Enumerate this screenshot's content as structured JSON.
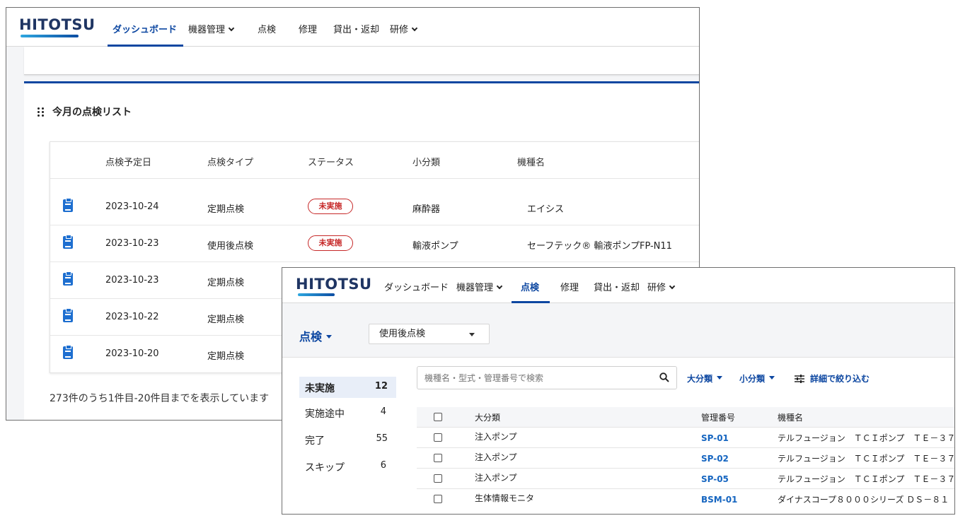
{
  "brand": {
    "logo": "HITOTSU",
    "colors": {
      "primary": "#0d47a1",
      "danger": "#c62828",
      "link": "#1565c0"
    }
  },
  "screen1": {
    "nav": {
      "items": [
        "ダッシュボード",
        "機器管理",
        "点検",
        "修理",
        "貸出・返却",
        "研修"
      ],
      "active": "ダッシュボード"
    },
    "card_title": "今月の点検リスト",
    "columns": [
      "点検予定日",
      "点検タイプ",
      "ステータス",
      "小分類",
      "機種名"
    ],
    "rows": [
      {
        "date": "2023-10-24",
        "type": "定期点検",
        "status": "未実施",
        "category": "麻酔器",
        "model": "エイシス"
      },
      {
        "date": "2023-10-23",
        "type": "使用後点検",
        "status": "未実施",
        "category": "輸液ポンプ",
        "model": "セーフテック® 輸液ポンプFP-N11"
      },
      {
        "date": "2023-10-23",
        "type": "定期点検",
        "status": "",
        "category": "",
        "model": ""
      },
      {
        "date": "2023-10-22",
        "type": "定期点検",
        "status": "",
        "category": "",
        "model": ""
      },
      {
        "date": "2023-10-20",
        "type": "定期点検",
        "status": "",
        "category": "",
        "model": ""
      }
    ],
    "footer": "273件のうち1件目-20件目までを表示しています",
    "icons": {
      "drag": "drag-handle-icon",
      "row": "clipboard-icon"
    }
  },
  "screen2": {
    "nav": {
      "items": [
        "ダッシュボード",
        "機器管理",
        "点検",
        "修理",
        "貸出・返却",
        "研修"
      ],
      "active": "点検"
    },
    "page_title": "点検",
    "inspection_type": "使用後点検",
    "statuses": [
      {
        "label": "未実施",
        "count": "12"
      },
      {
        "label": "実施途中",
        "count": "4"
      },
      {
        "label": "完了",
        "count": "55"
      },
      {
        "label": "スキップ",
        "count": "6"
      }
    ],
    "search_placeholder": "機種名・型式・管理番号で検索",
    "filters": {
      "major": "大分類",
      "minor": "小分類",
      "detail": "詳細で絞り込む"
    },
    "columns": [
      "大分類",
      "管理番号",
      "機種名"
    ],
    "rows": [
      {
        "major": "注入ポンプ",
        "id": "SP-01",
        "model": "テルフュージョン　ＴＣＩポンプ　ＴＥ－３７"
      },
      {
        "major": "注入ポンプ",
        "id": "SP-02",
        "model": "テルフュージョン　ＴＣＩポンプ　ＴＥ－３７"
      },
      {
        "major": "注入ポンプ",
        "id": "SP-05",
        "model": "テルフュージョン　ＴＣＩポンプ　ＴＥ－３７"
      },
      {
        "major": "生体情報モニタ",
        "id": "BSM-01",
        "model": "ダイナスコープ８０００シリーズ ＤＳ－８１"
      }
    ]
  }
}
